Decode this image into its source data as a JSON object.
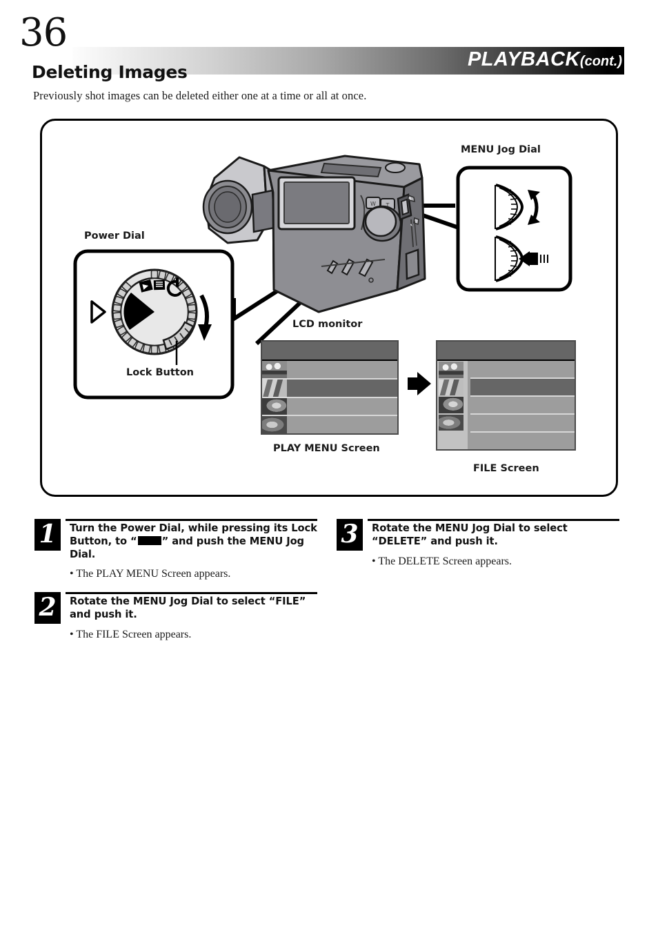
{
  "header": {
    "page_number": "36",
    "title": "PLAYBACK",
    "title_cont": "(cont.)"
  },
  "section": {
    "title": "Deleting Images",
    "intro": "Previously shot images can be deleted either one at a time or all at once."
  },
  "figure": {
    "labels": {
      "menu_jog_dial": "MENU Jog Dial",
      "power_dial": "Power Dial",
      "lock_button": "Lock Button",
      "lcd_monitor": "LCD monitor",
      "play_menu_screen": "PLAY MENU Screen",
      "file_screen": "FILE Screen"
    },
    "colors": {
      "screen_background": "#9d9d9d",
      "screen_header": "#666666",
      "screen_selected_row": "#666666",
      "screen_border": "#4a4a4a",
      "camera_body": "#8e8e93",
      "camera_body_dark": "#6f6f74",
      "outline": "#000000"
    }
  },
  "steps": [
    {
      "number": "1",
      "head_before": "Turn the Power Dial, while pressing its Lock Button, to “",
      "head_after": "” and push the MENU Jog Dial.",
      "note": "• The PLAY MENU Screen appears."
    },
    {
      "number": "2",
      "head": "Rotate the MENU Jog Dial to select “FILE” and push it.",
      "note": "• The FILE Screen appears."
    },
    {
      "number": "3",
      "head": "Rotate the MENU Jog Dial to select “DELETE” and push it.",
      "note": "• The DELETE Screen appears."
    }
  ],
  "icons": {
    "mode_playback_block": "playback-mode-block-icon",
    "jog_rotate": "jog-dial-rotate-icon",
    "jog_push": "jog-dial-push-icon",
    "transition_arrow": "right-arrow-icon",
    "dial_rotate_arrow": "dial-rotate-arrow-icon"
  }
}
